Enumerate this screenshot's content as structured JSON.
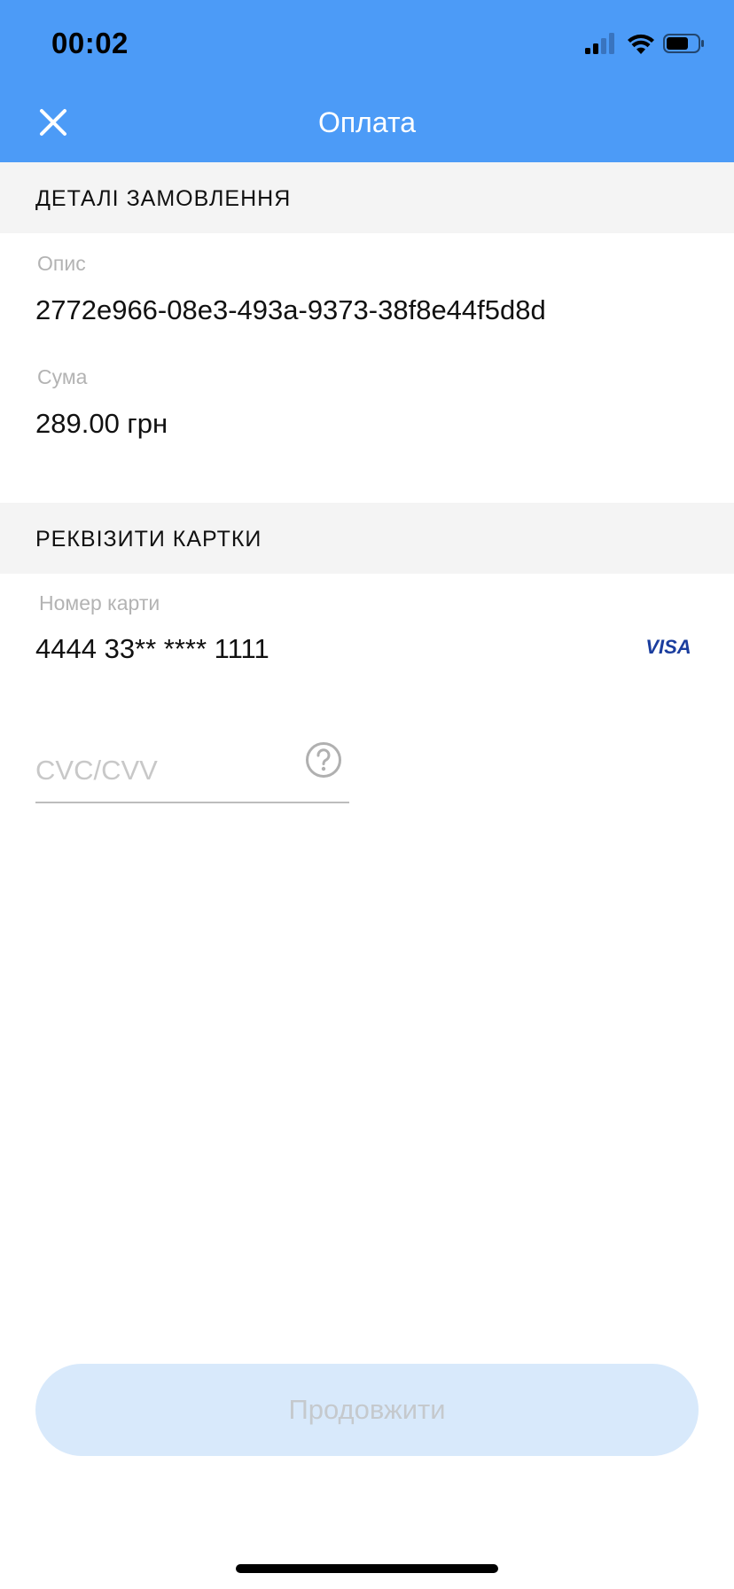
{
  "status_bar": {
    "time": "00:02",
    "icons": [
      "cellular-signal-icon",
      "wifi-icon",
      "battery-icon"
    ]
  },
  "nav": {
    "close_icon": "close-icon",
    "title": "Оплата"
  },
  "order_details": {
    "section_title": "ДЕТАЛІ ЗАМОВЛЕННЯ",
    "description_label": "Опис",
    "description_value": "2772e966-08e3-493a-9373-38f8e44f5d8d",
    "amount_label": "Сума",
    "amount_value": "289.00 грн"
  },
  "card_details": {
    "section_title": "РЕКВІЗИТИ КАРТКИ",
    "card_number_label": "Номер карти",
    "card_number_value": "4444 33** **** 1111",
    "card_brand": "VISA",
    "cvc_placeholder": "CVC/CVV",
    "cvc_value": "",
    "help_icon": "question-circle-icon"
  },
  "actions": {
    "continue_label": "Продовжити",
    "continue_enabled": false
  },
  "colors": {
    "header_bg": "#4c9bf7",
    "section_bg": "#f4f4f4",
    "label": "#b3b3b3",
    "visa_blue": "#1a3d9e",
    "button_bg_disabled": "#d8e9fb",
    "button_text_disabled": "#c5c9cd"
  }
}
